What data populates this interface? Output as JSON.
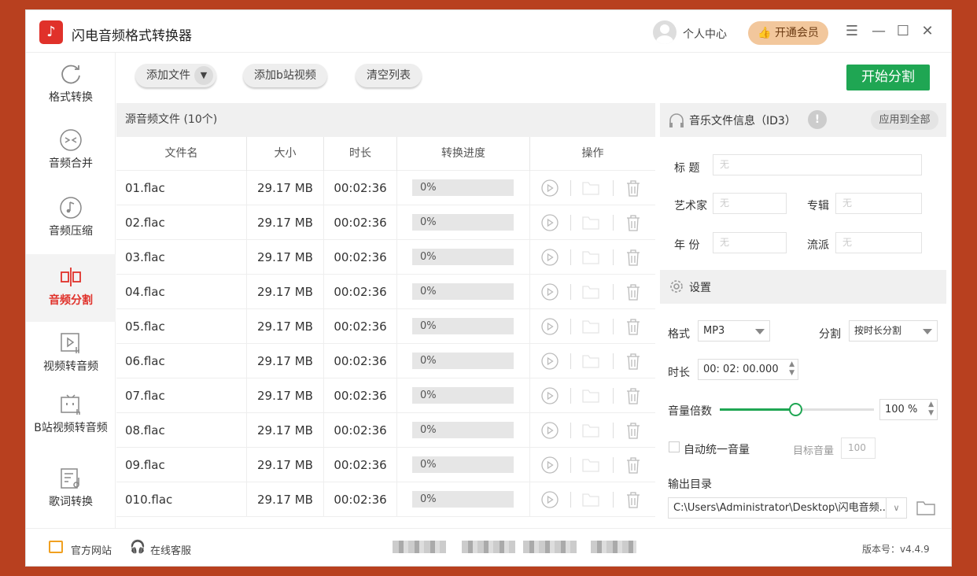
{
  "app": {
    "title": "闪电音频格式转换器",
    "user_center": "个人中心",
    "vip": "开通会员"
  },
  "sidebar": {
    "items": [
      {
        "label": "格式转换"
      },
      {
        "label": "音频合并"
      },
      {
        "label": "音频压缩"
      },
      {
        "label": "音频分割"
      },
      {
        "label": "视频转音频"
      },
      {
        "label": "B站视频转音频"
      },
      {
        "label": "歌词转换"
      }
    ]
  },
  "toolbar": {
    "add_file": "添加文件",
    "add_bili": "添加b站视频",
    "clear": "清空列表",
    "start": "开始分割"
  },
  "table": {
    "title": "源音频文件 (10个)",
    "headers": [
      "文件名",
      "大小",
      "时长",
      "转换进度",
      "操作"
    ],
    "rows": [
      {
        "name": "01.flac",
        "size": "29.17 MB",
        "duration": "00:02:36",
        "progress": "0%"
      },
      {
        "name": "02.flac",
        "size": "29.17 MB",
        "duration": "00:02:36",
        "progress": "0%"
      },
      {
        "name": "03.flac",
        "size": "29.17 MB",
        "duration": "00:02:36",
        "progress": "0%"
      },
      {
        "name": "04.flac",
        "size": "29.17 MB",
        "duration": "00:02:36",
        "progress": "0%"
      },
      {
        "name": "05.flac",
        "size": "29.17 MB",
        "duration": "00:02:36",
        "progress": "0%"
      },
      {
        "name": "06.flac",
        "size": "29.17 MB",
        "duration": "00:02:36",
        "progress": "0%"
      },
      {
        "name": "07.flac",
        "size": "29.17 MB",
        "duration": "00:02:36",
        "progress": "0%"
      },
      {
        "name": "08.flac",
        "size": "29.17 MB",
        "duration": "00:02:36",
        "progress": "0%"
      },
      {
        "name": "09.flac",
        "size": "29.17 MB",
        "duration": "00:02:36",
        "progress": "0%"
      },
      {
        "name": "010.flac",
        "size": "29.17 MB",
        "duration": "00:02:36",
        "progress": "0%"
      }
    ]
  },
  "id3": {
    "title": "音乐文件信息（ID3）",
    "apply_all": "应用到全部",
    "title_label": "标  题",
    "artist_label": "艺术家",
    "album_label": "专辑",
    "year_label": "年  份",
    "genre_label": "流派",
    "placeholder": "无"
  },
  "settings": {
    "title": "设置",
    "format_label": "格式",
    "format_value": "MP3",
    "split_label": "分割",
    "split_value": "按时长分割",
    "duration_label": "时长",
    "duration_value": "00: 02: 00.000",
    "volume_label": "音量倍数",
    "volume_value": "100",
    "volume_unit": "%",
    "volume_fraction": 0.49,
    "auto_volume_label": "自动统一音量",
    "target_volume_label": "目标音量",
    "target_volume_value": "100",
    "output_label": "输出目录",
    "output_path": "C:\\Users\\Administrator\\Desktop\\闪电音频..."
  },
  "footer": {
    "website": "官方网站",
    "support": "在线客服",
    "version": "版本号：v4.4.9"
  },
  "colors": {
    "brand": "#e0312a",
    "start": "#1fa653",
    "slider": "#1fa653",
    "vip": "#f2c79c"
  }
}
